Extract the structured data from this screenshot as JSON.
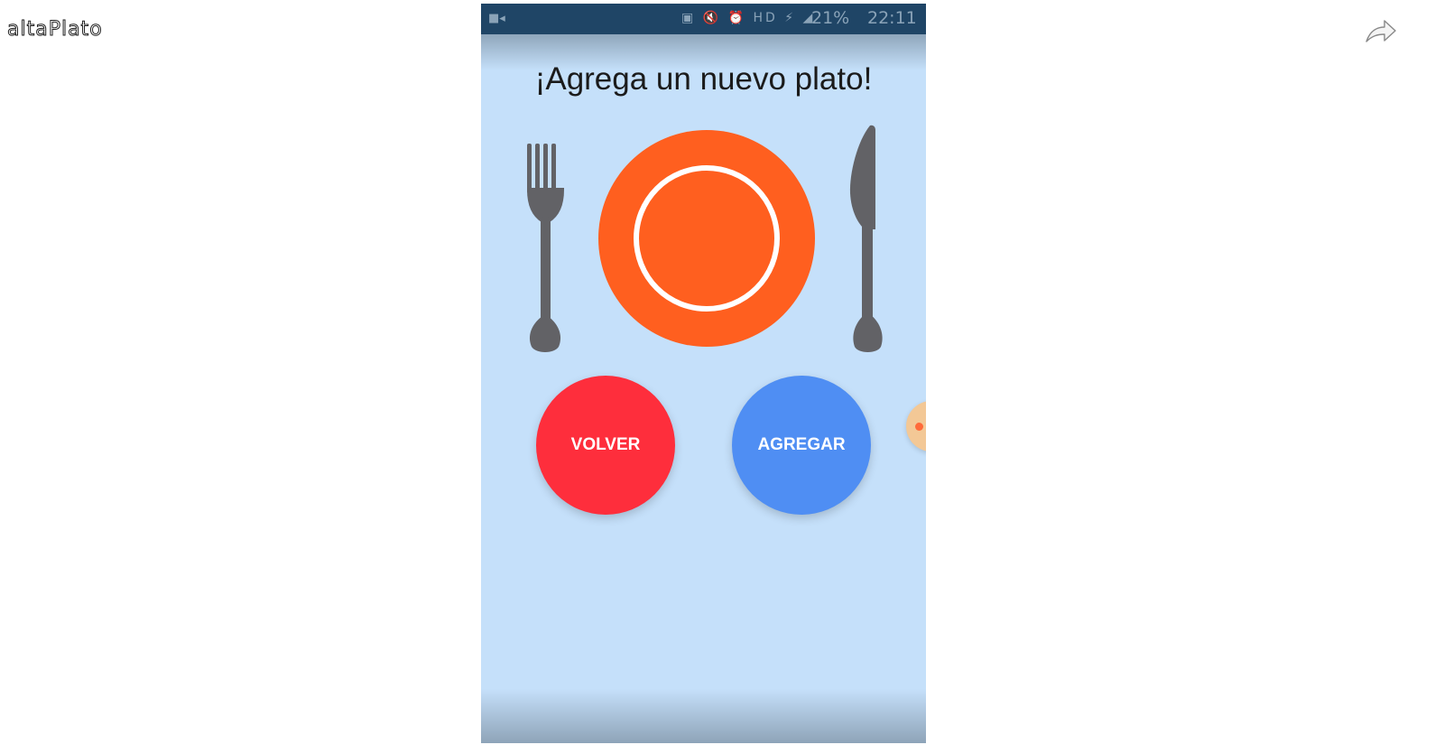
{
  "video": {
    "title": "altaPlato",
    "share_icon": "share-arrow-icon"
  },
  "statusbar": {
    "left_icon": "video-camera-icon",
    "icons": "▣ 🔇 ⏰ HD ⚡ ◢",
    "battery": "21%",
    "time": "22:11"
  },
  "screen": {
    "title": "¡Agrega un nuevo plato!",
    "buttons": {
      "back": "VOLVER",
      "add": "AGREGAR"
    }
  },
  "colors": {
    "background": "#c5e0fa",
    "plate": "#ff5f1f",
    "utensils": "#626266",
    "back_button": "#fe2e3c",
    "add_button": "#4f8ef3"
  }
}
